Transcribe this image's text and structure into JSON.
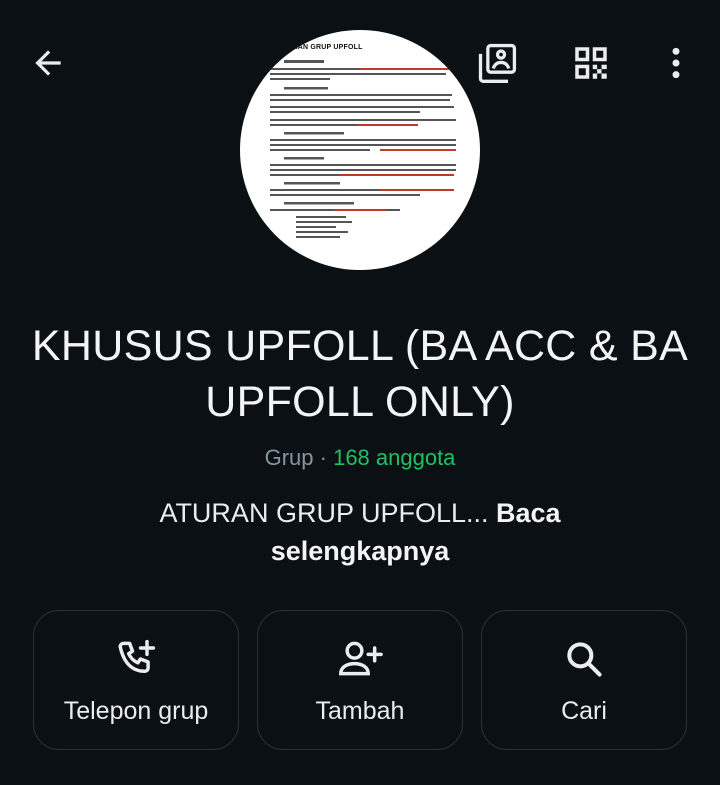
{
  "header": {
    "back_icon": "arrow-left-icon",
    "gallery_icon": "media-gallery-icon",
    "qr_icon": "qr-code-icon",
    "more_icon": "more-vertical-icon"
  },
  "avatar": {
    "doc_title": "ATURAN GRUP UPFOLL"
  },
  "group": {
    "name": "KHUSUS UPFOLL (BA ACC & BA UPFOLL ONLY)",
    "kind": "Grup",
    "separator": "·",
    "members": "168 anggota"
  },
  "description": {
    "text": "ATURAN GRUP UPFOLL...",
    "read_more": "Baca selengkapnya"
  },
  "actions": [
    {
      "label": "Telepon grup",
      "icon": "add-call-icon"
    },
    {
      "label": "Tambah",
      "icon": "add-person-icon"
    },
    {
      "label": "Cari",
      "icon": "search-icon"
    }
  ],
  "colors": {
    "background": "#0b1014",
    "accent_green": "#21c063",
    "muted": "#8696a0",
    "card_border": "#2a3236"
  }
}
